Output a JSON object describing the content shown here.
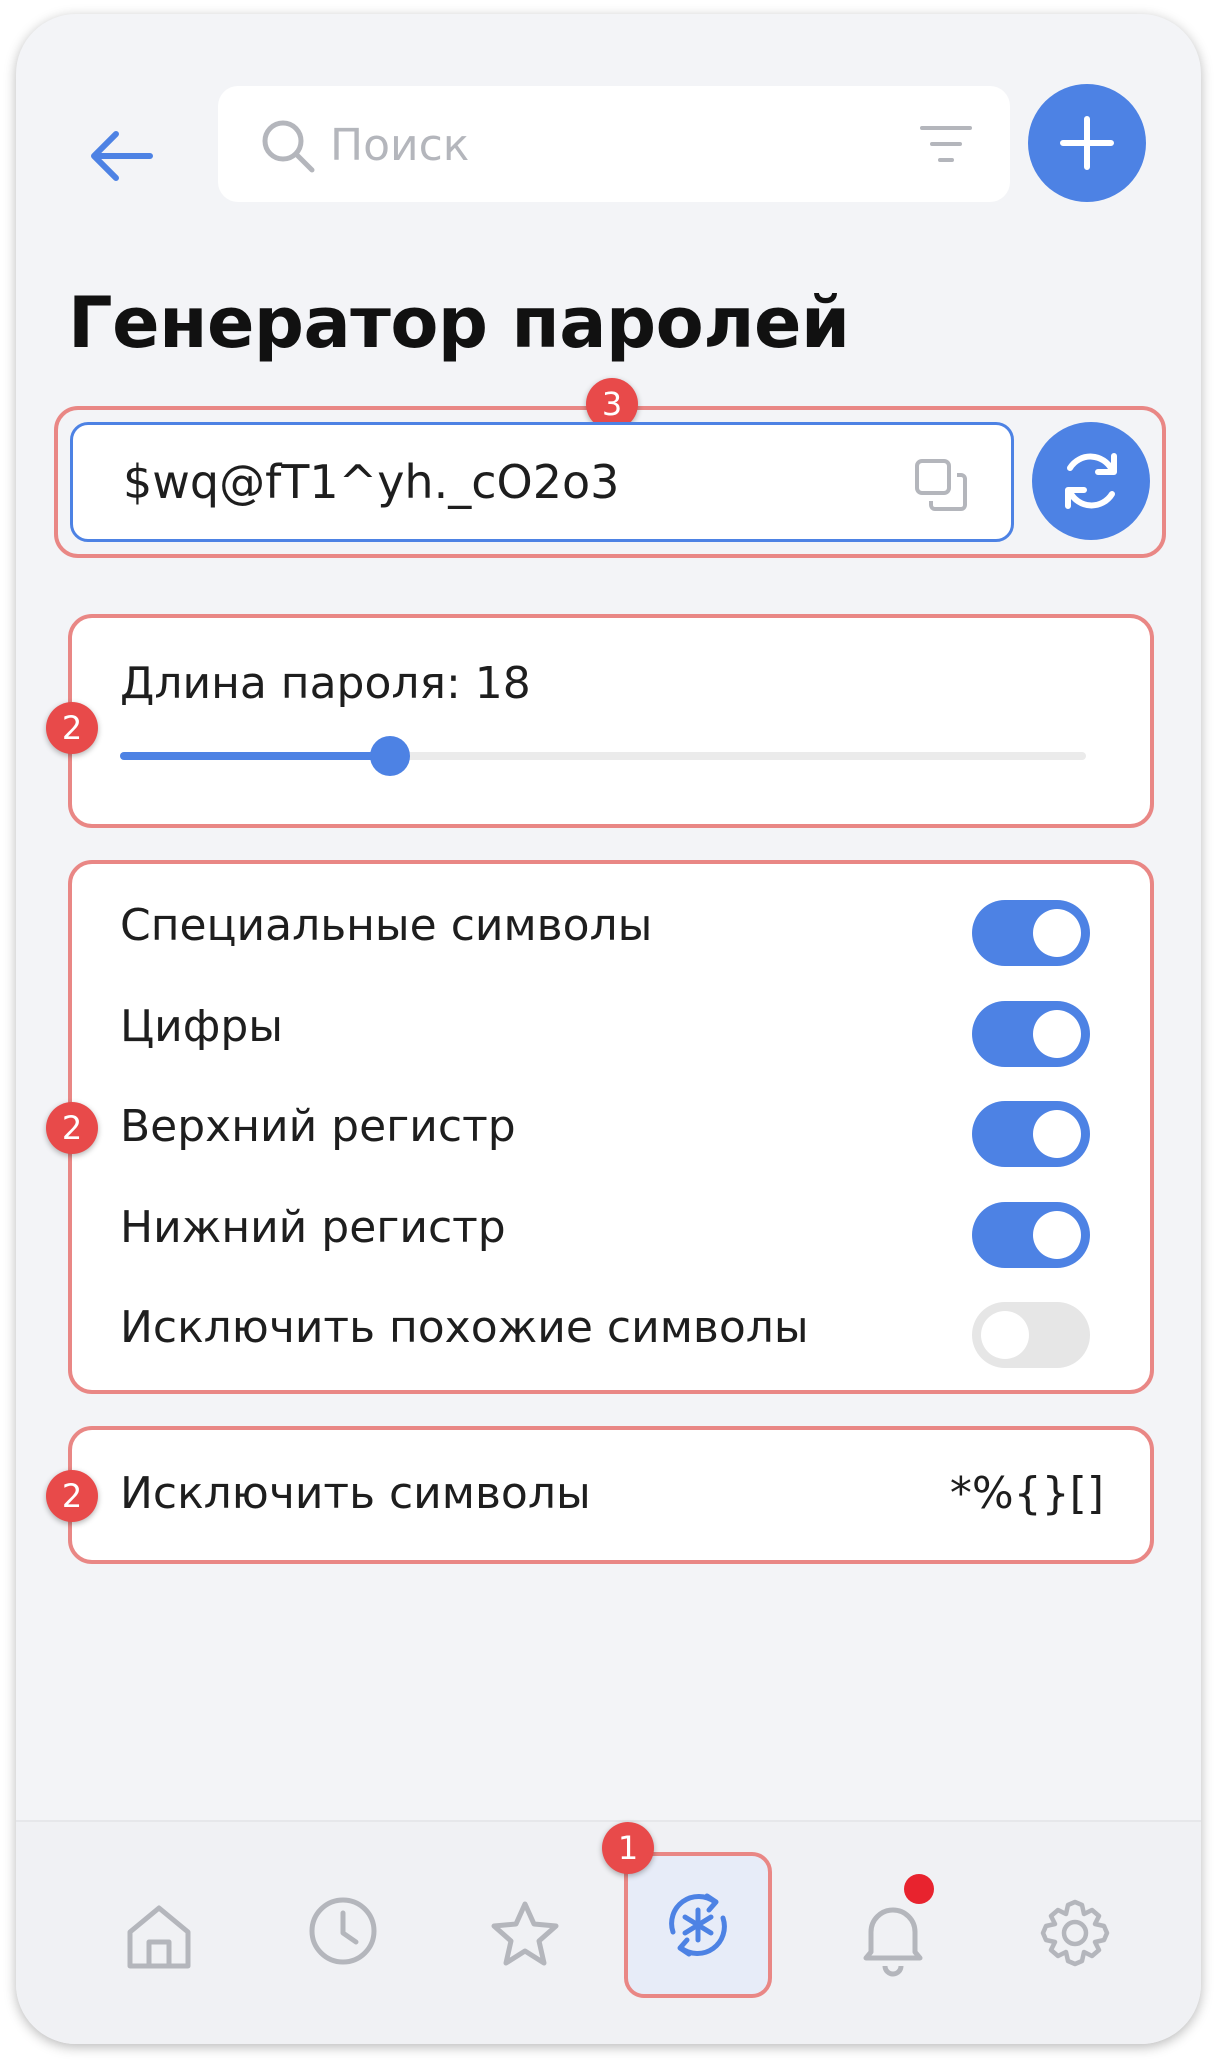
{
  "header": {
    "search_placeholder": "Поиск"
  },
  "page": {
    "title": "Генератор паролей"
  },
  "password": {
    "value": "$wq@fT1^yh._cO2o3"
  },
  "length": {
    "label": "Длина пароля: 18",
    "value": 18,
    "slider_fraction": 0.28
  },
  "options": [
    {
      "label": "Специальные символы",
      "enabled": true
    },
    {
      "label": "Цифры",
      "enabled": true
    },
    {
      "label": "Верхний регистр",
      "enabled": true
    },
    {
      "label": "Нижний регистр",
      "enabled": true
    },
    {
      "label": "Исключить похожие символы",
      "enabled": false
    }
  ],
  "exclude": {
    "label": "Исключить символы",
    "value": "*%{}[]"
  },
  "badges": {
    "password_row": "3",
    "length_card": "2",
    "options_card": "2",
    "exclude_card": "2",
    "nav_generator": "1"
  },
  "nav": {
    "items": [
      "home-icon",
      "clock-icon",
      "star-icon",
      "generator-icon",
      "bell-icon",
      "gear-icon"
    ],
    "active": "generator-icon",
    "notification_dot": true
  },
  "colors": {
    "accent": "#4d82e4",
    "annotation": "#e98785",
    "badge": "#e84a4a",
    "notification": "#e8232e"
  }
}
